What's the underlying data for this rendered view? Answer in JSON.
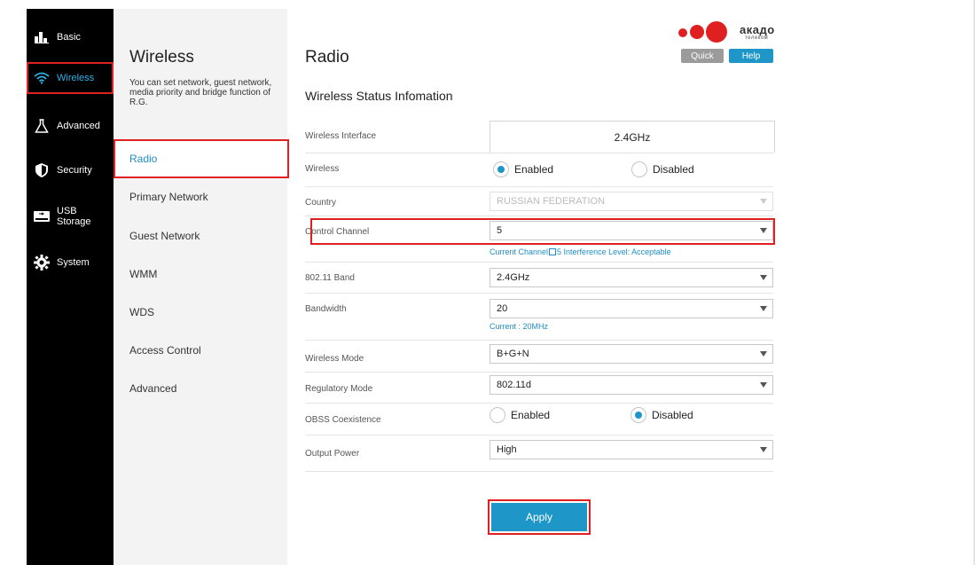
{
  "nav": {
    "items": [
      {
        "label": "Basic",
        "icon": "bar-chart-icon"
      },
      {
        "label": "Wireless",
        "icon": "wifi-icon"
      },
      {
        "label": "Advanced",
        "icon": "flask-icon"
      },
      {
        "label": "Security",
        "icon": "shield-icon"
      },
      {
        "label": "USB",
        "label2": "Storage",
        "icon": "usb-storage-icon"
      },
      {
        "label": "System",
        "icon": "gear-icon"
      }
    ]
  },
  "sub": {
    "title": "Wireless",
    "description": "You can set network, guest network, media priority and bridge function of R.G.",
    "items": [
      {
        "label": "Radio"
      },
      {
        "label": "Primary Network"
      },
      {
        "label": "Guest Network"
      },
      {
        "label": "WMM"
      },
      {
        "label": "WDS"
      },
      {
        "label": "Access Control"
      },
      {
        "label": "Advanced"
      }
    ]
  },
  "header": {
    "title": "Radio",
    "logo_text": "акадо",
    "logo_subtext": "телеком",
    "quick_label": "Quick",
    "help_label": "Help"
  },
  "section_title": "Wireless Status Infomation",
  "form": {
    "interface": {
      "label": "Wireless Interface",
      "value": "2.4GHz"
    },
    "wireless": {
      "label": "Wireless",
      "opt1": "Enabled",
      "opt2": "Disabled",
      "selected": "Enabled"
    },
    "country": {
      "label": "Country",
      "value": "RUSSIAN FEDERATION"
    },
    "control_channel": {
      "label": "Control Channel",
      "value": "5",
      "hint_prefix": "Current Channel",
      "hint_suffix": "5 Interference Level: Acceptable"
    },
    "band": {
      "label": "802.11 Band",
      "value": "2.4GHz"
    },
    "bandwidth": {
      "label": "Bandwidth",
      "value": "20",
      "hint": "Current : 20MHz"
    },
    "mode": {
      "label": "Wireless Mode",
      "value": "B+G+N"
    },
    "regulatory": {
      "label": "Regulatory Mode",
      "value": "802.11d"
    },
    "obss": {
      "label": "OBSS Coexistence",
      "opt1": "Enabled",
      "opt2": "Disabled",
      "selected": "Disabled"
    },
    "power": {
      "label": "Output Power",
      "value": "High"
    }
  },
  "apply_label": "Apply",
  "colors": {
    "accent": "#1e96c8",
    "highlight": "#e02020",
    "nav_bg": "#000000",
    "active_text": "#2fb2e8"
  }
}
